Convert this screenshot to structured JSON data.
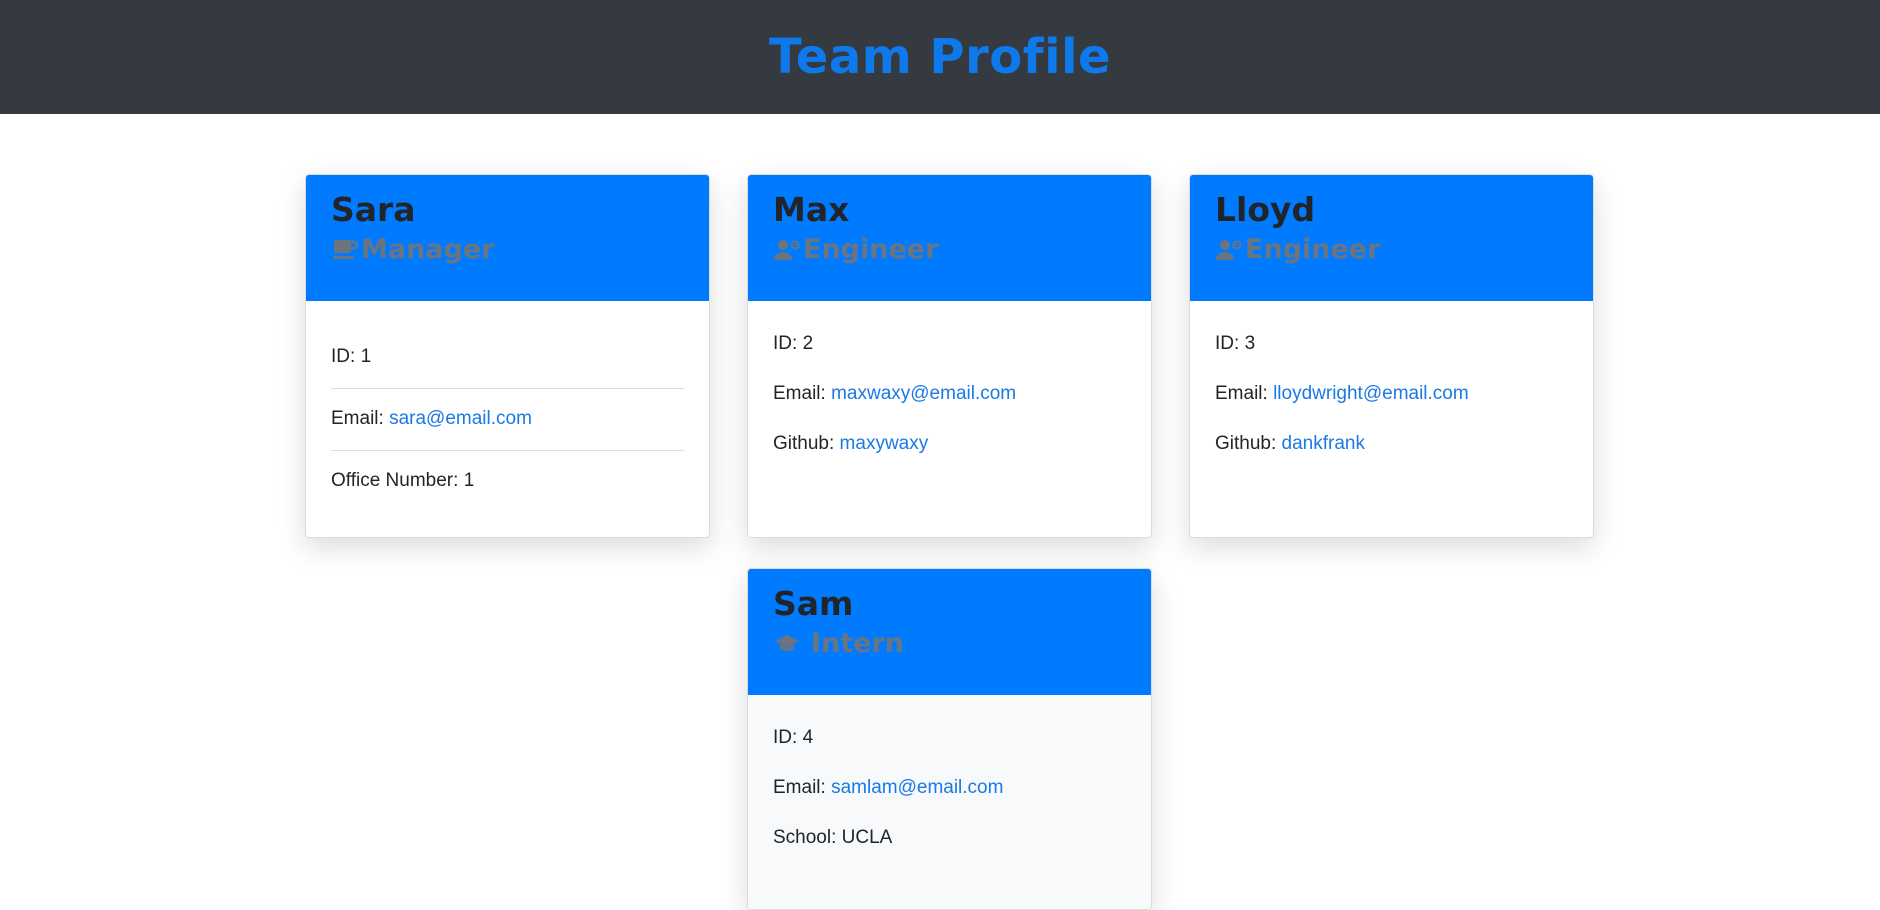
{
  "page": {
    "title": "Team Profile",
    "colors": {
      "header_bg": "#343a40",
      "title": "#0d79ea",
      "card_head": "#007bff",
      "role_text": "#6c757d",
      "link": "#1a79e6"
    }
  },
  "cards": [
    {
      "name": "Sara",
      "role": "Manager",
      "role_icon": "coffee-mug-icon",
      "fields": [
        {
          "label": "ID: ",
          "value": "1"
        },
        {
          "label": "Email: ",
          "value": "sara@email.com"
        },
        {
          "label": "Office Number: ",
          "value": "1"
        }
      ]
    },
    {
      "name": "Max",
      "role": "Engineer",
      "role_icon": "user-cog-icon",
      "fields": [
        {
          "label": "ID: ",
          "value": "2"
        },
        {
          "label": "Email: ",
          "value": "maxwaxy@email.com"
        },
        {
          "label": "Github: ",
          "value": "maxywaxy"
        }
      ]
    },
    {
      "name": "Lloyd",
      "role": "Engineer",
      "role_icon": "user-cog-icon",
      "fields": [
        {
          "label": "ID: ",
          "value": "3"
        },
        {
          "label": "Email: ",
          "value": "lloydwright@email.com"
        },
        {
          "label": "Github: ",
          "value": "dankfrank"
        }
      ]
    },
    {
      "name": "Sam",
      "role": "Intern",
      "role_icon": "graduation-cap-icon",
      "fields": [
        {
          "label": "ID: ",
          "value": "4"
        },
        {
          "label": "Email: ",
          "value": "samlam@email.com"
        },
        {
          "label": "School: ",
          "value": "UCLA"
        }
      ]
    }
  ]
}
